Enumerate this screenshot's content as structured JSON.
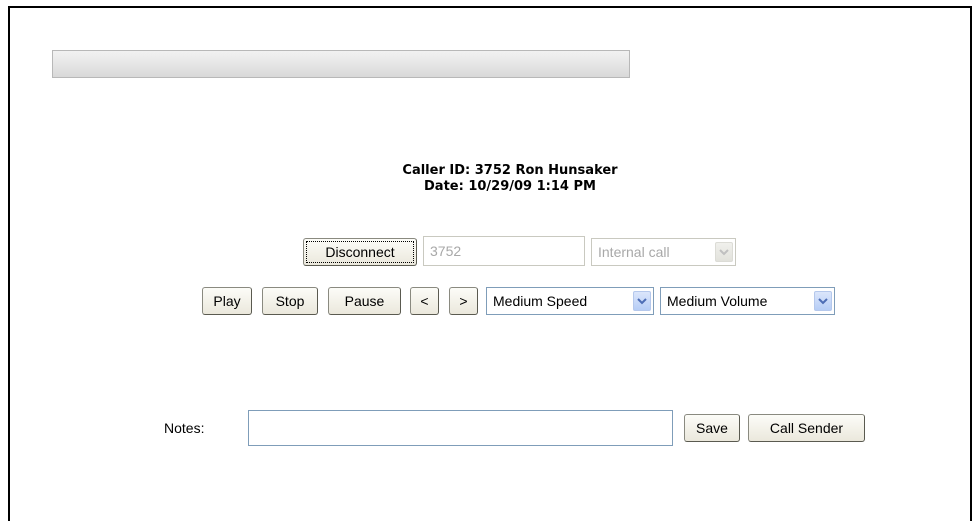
{
  "progress": {
    "value": 0
  },
  "call_info": {
    "caller_id": "Caller ID: 3752 Ron Hunsaker",
    "date": "Date: 10/29/09 1:14 PM"
  },
  "connection": {
    "disconnect_label": "Disconnect",
    "number_value": "3752",
    "call_type": "Internal call"
  },
  "playback": {
    "play_label": "Play",
    "stop_label": "Stop",
    "pause_label": "Pause",
    "prev_label": "<",
    "next_label": ">",
    "speed": "Medium Speed",
    "volume": "Medium Volume"
  },
  "notes": {
    "label": "Notes:",
    "value": "",
    "save_label": "Save",
    "call_sender_label": "Call Sender"
  },
  "colors": {
    "arrow_blue": "#4d6db5",
    "arrow_disabled": "#c0c0c0"
  },
  "icons": {
    "dropdown": "chevron-down-icon"
  }
}
